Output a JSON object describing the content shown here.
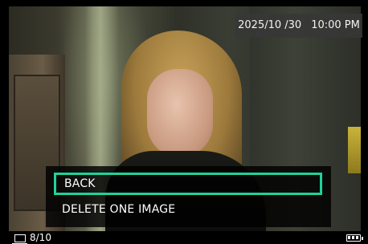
{
  "overlay": {
    "date": "2025/10 /30",
    "time": "10:00 PM"
  },
  "menu": {
    "items": [
      {
        "label": "BACK",
        "selected": true
      },
      {
        "label": "DELETE ONE IMAGE",
        "selected": false
      }
    ],
    "selection_color": "#1ed39a"
  },
  "status_bar": {
    "frame_icon": "frame-icon",
    "image_counter": "8/10",
    "battery_icon": "battery-icon",
    "battery_level": 1.0
  },
  "photo": {
    "icon": "photo-preview"
  }
}
